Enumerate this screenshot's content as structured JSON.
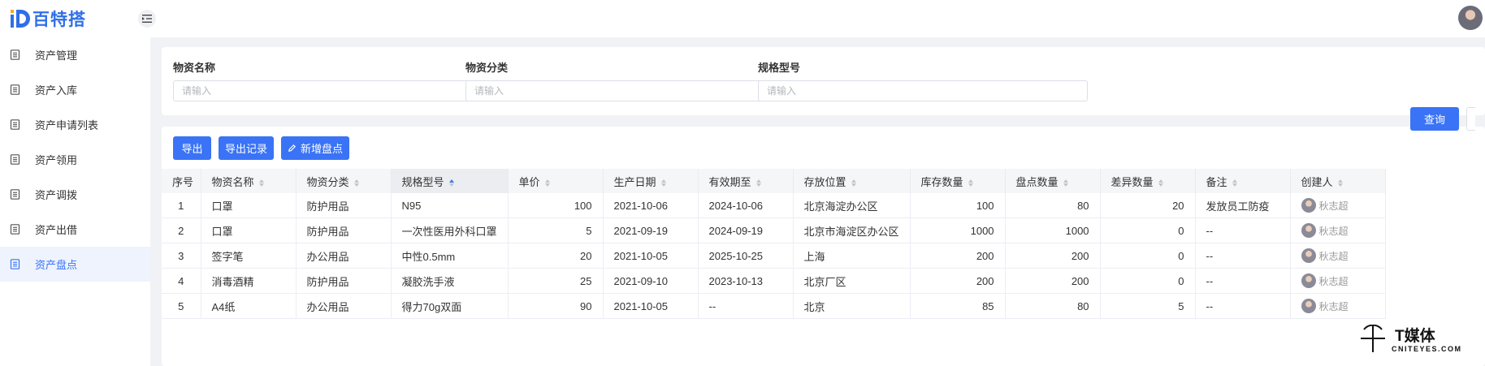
{
  "brand": {
    "name": "百特搭",
    "color": "#2f6fe8"
  },
  "header": {
    "toggle_icon": "menu-fold-icon"
  },
  "sidebar": {
    "items": [
      {
        "label": "资产管理",
        "icon": "document-icon",
        "active": false
      },
      {
        "label": "资产入库",
        "icon": "document-icon",
        "active": false
      },
      {
        "label": "资产申请列表",
        "icon": "document-icon",
        "active": false
      },
      {
        "label": "资产领用",
        "icon": "document-icon",
        "active": false
      },
      {
        "label": "资产调拨",
        "icon": "document-icon",
        "active": false
      },
      {
        "label": "资产出借",
        "icon": "document-icon",
        "active": false
      },
      {
        "label": "资产盘点",
        "icon": "document-icon",
        "active": true
      }
    ]
  },
  "filters": {
    "name": {
      "label": "物资名称",
      "placeholder": "请输入",
      "value": ""
    },
    "category": {
      "label": "物资分类",
      "placeholder": "请输入",
      "value": ""
    },
    "spec": {
      "label": "规格型号",
      "placeholder": "请输入",
      "value": ""
    },
    "query_label": "查询"
  },
  "toolbar": {
    "export_label": "导出",
    "export_log_label": "导出记录",
    "add_label": "新增盘点"
  },
  "table": {
    "columns": [
      "序号",
      "物资名称",
      "物资分类",
      "规格型号",
      "单价",
      "生产日期",
      "有效期至",
      "存放位置",
      "库存数量",
      "盘点数量",
      "差异数量",
      "备注",
      "创建人"
    ],
    "sorted_column": "规格型号",
    "sort_direction": "asc",
    "rows": [
      [
        "1",
        "口罩",
        "防护用品",
        "N95",
        "100",
        "2021-10-06",
        "2024-10-06",
        "北京海淀办公区",
        "100",
        "80",
        "20",
        "发放员工防疫",
        "秋志超"
      ],
      [
        "2",
        "口罩",
        "防护用品",
        "一次性医用外科口罩",
        "5",
        "2021-09-19",
        "2024-09-19",
        "北京市海淀区办公区",
        "1000",
        "1000",
        "0",
        "--",
        "秋志超"
      ],
      [
        "3",
        "签字笔",
        "办公用品",
        "中性0.5mm",
        "20",
        "2021-10-05",
        "2025-10-25",
        "上海",
        "200",
        "200",
        "0",
        "--",
        "秋志超"
      ],
      [
        "4",
        "消毒酒精",
        "防护用品",
        "凝胶洗手液",
        "25",
        "2021-09-10",
        "2023-10-13",
        "北京厂区",
        "200",
        "200",
        "0",
        "--",
        "秋志超"
      ],
      [
        "5",
        "A4纸",
        "办公用品",
        "得力70g双面",
        "90",
        "2021-10-05",
        "--",
        "北京",
        "85",
        "80",
        "5",
        "--",
        "秋志超"
      ]
    ]
  },
  "watermark": {
    "brand": "T媒体",
    "domain": "CNITEYES.COM"
  },
  "accent_color": "#3a73f5"
}
